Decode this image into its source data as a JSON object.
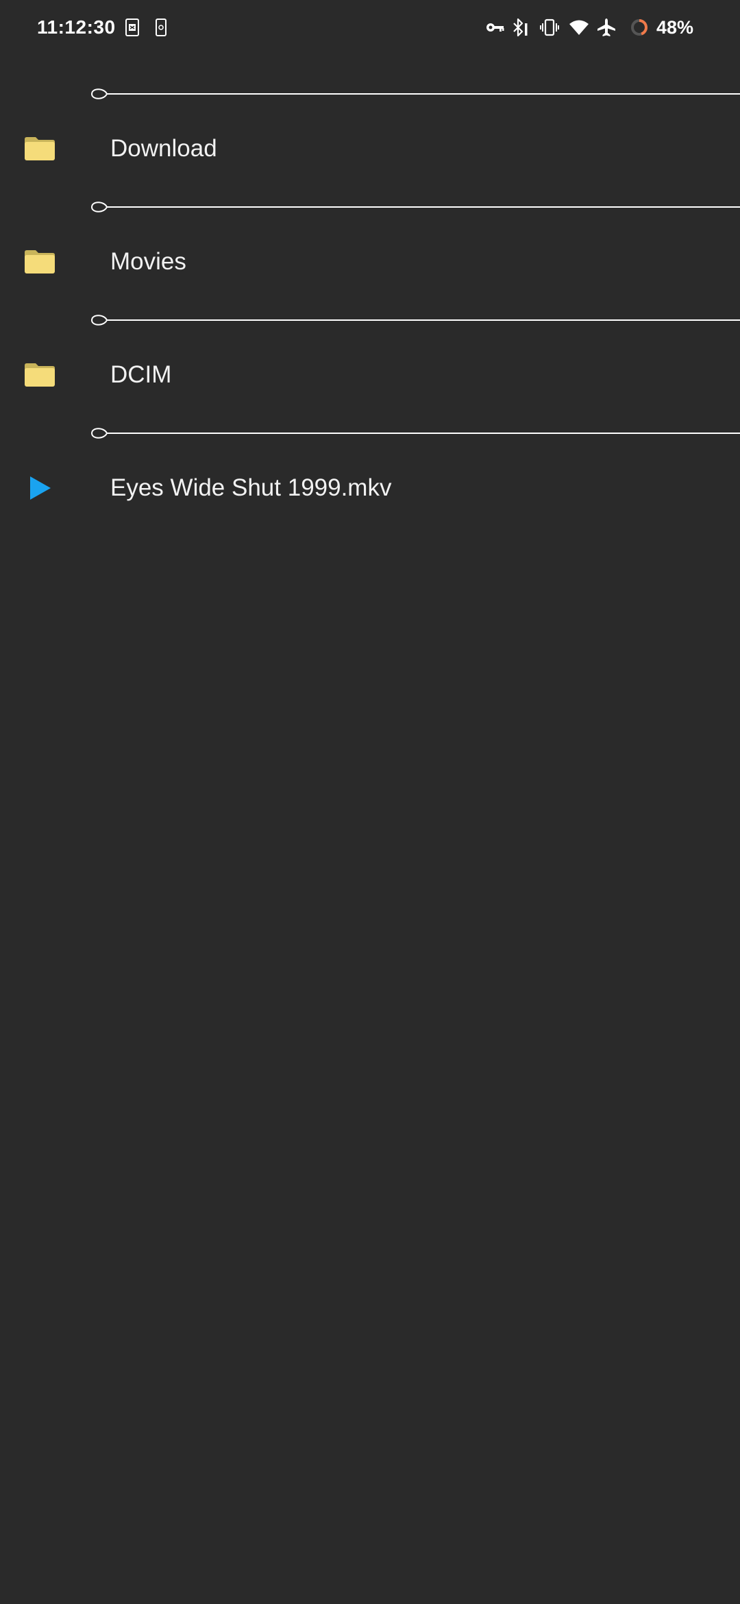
{
  "status_bar": {
    "time": "11:12:30",
    "battery_percent": "48%",
    "icons": [
      "sim-card-icon",
      "sim-card-small-icon",
      "vpn-key-icon",
      "bluetooth-icon",
      "vibrate-icon",
      "wifi-icon",
      "airplane-mode-icon",
      "battery-ring-icon"
    ]
  },
  "file_list": {
    "items": [
      {
        "label": "Download",
        "icon": "folder-icon",
        "type": "folder"
      },
      {
        "label": "Movies",
        "icon": "folder-icon",
        "type": "folder"
      },
      {
        "label": "DCIM",
        "icon": "folder-icon",
        "type": "folder"
      },
      {
        "label": "Eyes Wide Shut 1999.mkv",
        "icon": "play-icon",
        "type": "video"
      }
    ]
  },
  "colors": {
    "background": "#2a2a2a",
    "folder": "#f5dc7a",
    "folder_tab": "#c9b45a",
    "play": "#1aa3f0",
    "battery_ring": "#f07a4a",
    "text": "#f2f2f2"
  }
}
